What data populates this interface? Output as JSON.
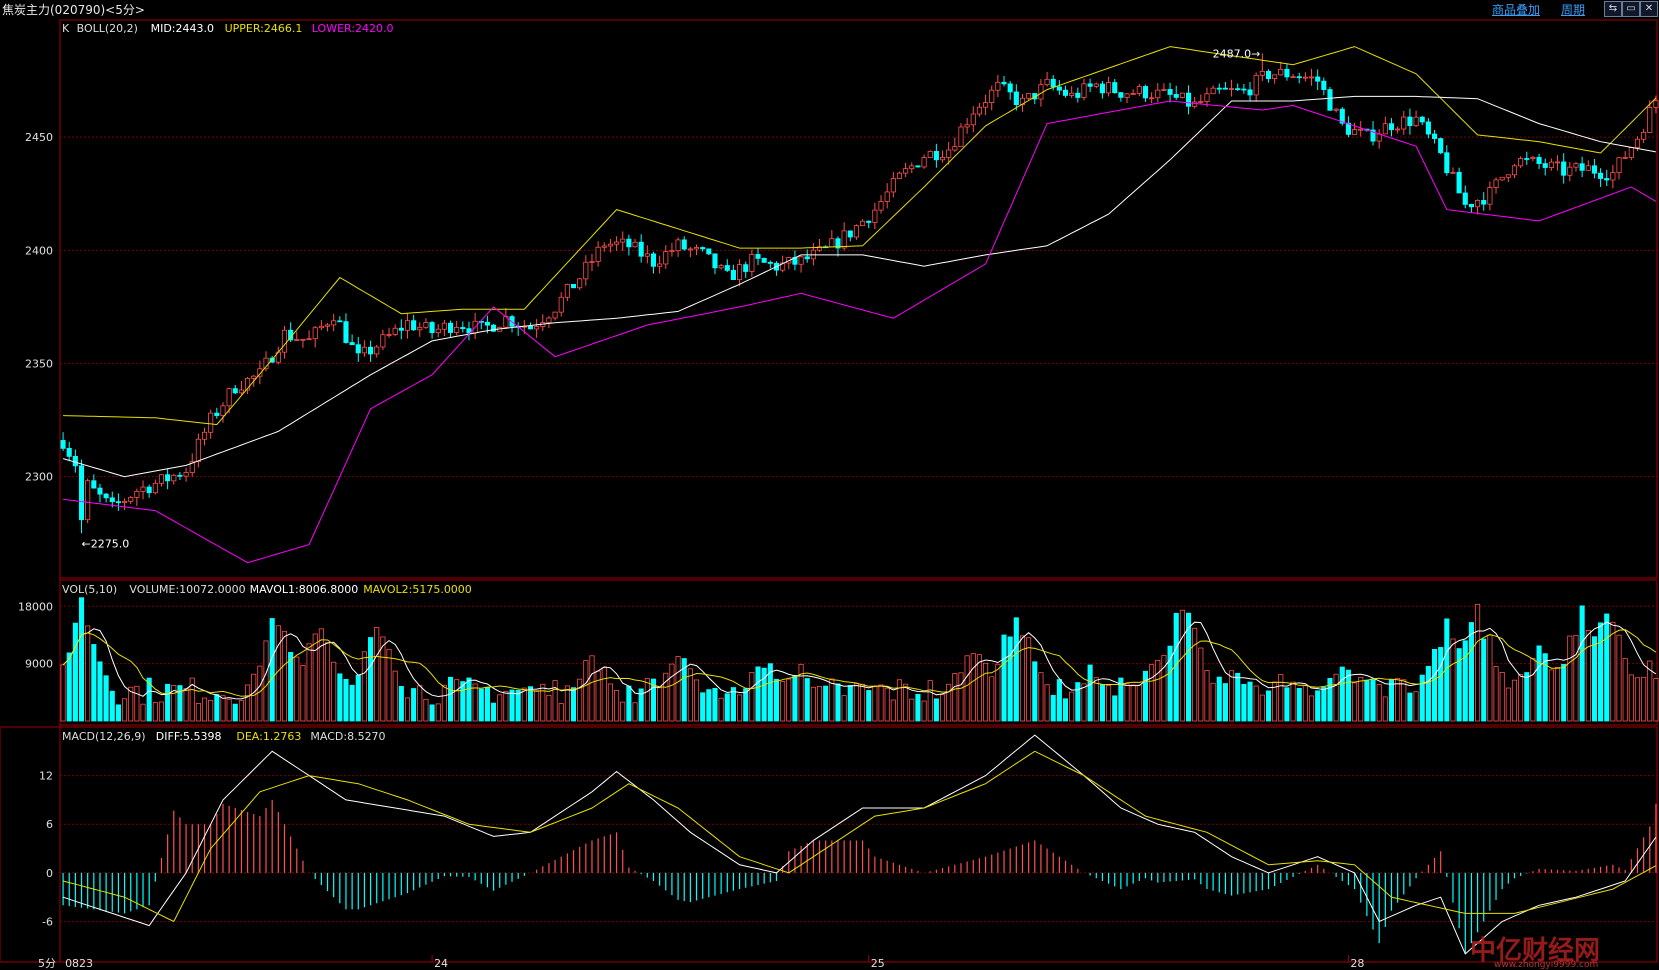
{
  "window": {
    "title": "焦炭主力(020790)<5分>",
    "btn_overlay": "商品叠加",
    "btn_period": "周期",
    "win_controls": [
      "⇆",
      "▭",
      "✕"
    ]
  },
  "colors": {
    "up": "#ff4f4f",
    "down": "#00ffff",
    "mid": "#ffffff",
    "upper": "#e8e000",
    "lower": "#ff00ff",
    "grid": "#7a0000",
    "frame": "#a00000",
    "axis_text": "#e0e0e0"
  },
  "chart_data": [
    {
      "type": "candlestick",
      "id": "price",
      "legend": {
        "prefix": "K",
        "indicator": "BOLL(20,2)",
        "mid": "MID:2443.0",
        "upper": "UPPER:2466.1",
        "lower": "LOWER:2420.0"
      },
      "y_ticks": [
        "2450",
        "2400",
        "2350",
        "2300"
      ],
      "y_tick_values": [
        2450,
        2400,
        2350,
        2300
      ],
      "ylim": [
        2257,
        2500
      ],
      "annotations": {
        "low": "←2275.0",
        "high": "2487.0→",
        "low_value": 2275,
        "high_value": 2487,
        "low_index": 3,
        "high_index": 195
      },
      "bar_count": 260,
      "mid_line": [
        [
          0,
          2308
        ],
        [
          10,
          2300
        ],
        [
          20,
          2305
        ],
        [
          35,
          2320
        ],
        [
          50,
          2345
        ],
        [
          60,
          2360
        ],
        [
          70,
          2365
        ],
        [
          80,
          2368
        ],
        [
          90,
          2370
        ],
        [
          100,
          2373
        ],
        [
          110,
          2385
        ],
        [
          120,
          2398
        ],
        [
          130,
          2398
        ],
        [
          140,
          2393
        ],
        [
          150,
          2398
        ],
        [
          160,
          2402
        ],
        [
          170,
          2416
        ],
        [
          180,
          2440
        ],
        [
          190,
          2466
        ],
        [
          200,
          2466
        ],
        [
          210,
          2468
        ],
        [
          220,
          2468
        ],
        [
          230,
          2467
        ],
        [
          240,
          2456
        ],
        [
          250,
          2448
        ],
        [
          260,
          2443
        ]
      ],
      "upper_line": [
        [
          0,
          2327
        ],
        [
          15,
          2326
        ],
        [
          25,
          2323
        ],
        [
          35,
          2355
        ],
        [
          45,
          2388
        ],
        [
          55,
          2372
        ],
        [
          65,
          2374
        ],
        [
          75,
          2374
        ],
        [
          90,
          2418
        ],
        [
          110,
          2401
        ],
        [
          120,
          2401
        ],
        [
          130,
          2402
        ],
        [
          140,
          2428
        ],
        [
          150,
          2455
        ],
        [
          160,
          2471
        ],
        [
          180,
          2490
        ],
        [
          200,
          2482
        ],
        [
          210,
          2490
        ],
        [
          220,
          2478
        ],
        [
          230,
          2451
        ],
        [
          240,
          2448
        ],
        [
          250,
          2443
        ],
        [
          260,
          2470
        ]
      ],
      "lower_line": [
        [
          0,
          2290
        ],
        [
          15,
          2285
        ],
        [
          30,
          2262
        ],
        [
          40,
          2270
        ],
        [
          50,
          2330
        ],
        [
          60,
          2345
        ],
        [
          70,
          2375
        ],
        [
          80,
          2353
        ],
        [
          95,
          2367
        ],
        [
          110,
          2375
        ],
        [
          120,
          2381
        ],
        [
          135,
          2370
        ],
        [
          150,
          2394
        ],
        [
          160,
          2456
        ],
        [
          180,
          2466
        ],
        [
          195,
          2462
        ],
        [
          200,
          2464
        ],
        [
          210,
          2455
        ],
        [
          220,
          2446
        ],
        [
          225,
          2418
        ],
        [
          240,
          2413
        ],
        [
          255,
          2428
        ],
        [
          260,
          2420
        ]
      ],
      "price_path": [
        [
          0,
          2316
        ],
        [
          4,
          2296
        ],
        [
          8,
          2286
        ],
        [
          12,
          2294
        ],
        [
          16,
          2298
        ],
        [
          20,
          2303
        ],
        [
          24,
          2325
        ],
        [
          28,
          2340
        ],
        [
          32,
          2345
        ],
        [
          36,
          2363
        ],
        [
          40,
          2360
        ],
        [
          44,
          2372
        ],
        [
          48,
          2352
        ],
        [
          52,
          2360
        ],
        [
          56,
          2368
        ],
        [
          60,
          2364
        ],
        [
          64,
          2368
        ],
        [
          68,
          2365
        ],
        [
          72,
          2370
        ],
        [
          76,
          2366
        ],
        [
          80,
          2375
        ],
        [
          84,
          2388
        ],
        [
          88,
          2403
        ],
        [
          92,
          2402
        ],
        [
          96,
          2395
        ],
        [
          100,
          2402
        ],
        [
          104,
          2398
        ],
        [
          108,
          2388
        ],
        [
          112,
          2395
        ],
        [
          116,
          2393
        ],
        [
          120,
          2395
        ],
        [
          124,
          2400
        ],
        [
          128,
          2408
        ],
        [
          132,
          2418
        ],
        [
          136,
          2432
        ],
        [
          140,
          2442
        ],
        [
          144,
          2445
        ],
        [
          148,
          2462
        ],
        [
          152,
          2472
        ],
        [
          156,
          2465
        ],
        [
          160,
          2473
        ],
        [
          164,
          2468
        ],
        [
          168,
          2473
        ],
        [
          172,
          2470
        ],
        [
          176,
          2470
        ],
        [
          180,
          2468
        ],
        [
          184,
          2464
        ],
        [
          188,
          2470
        ],
        [
          192,
          2470
        ],
        [
          196,
          2478
        ],
        [
          200,
          2478
        ],
        [
          204,
          2475
        ],
        [
          208,
          2455
        ],
        [
          212,
          2450
        ],
        [
          216,
          2456
        ],
        [
          220,
          2458
        ],
        [
          224,
          2442
        ],
        [
          228,
          2420
        ],
        [
          232,
          2425
        ],
        [
          236,
          2440
        ],
        [
          240,
          2438
        ],
        [
          244,
          2435
        ],
        [
          248,
          2436
        ],
        [
          252,
          2434
        ],
        [
          256,
          2450
        ],
        [
          260,
          2472
        ]
      ]
    },
    {
      "type": "bar",
      "id": "volume",
      "legend": {
        "indicator": "VOL(5,10)",
        "volume": "VOLUME:10072.0000",
        "mavol1": "MAVOL1:8006.8000",
        "mavol2": "MAVOL2:5175.0000"
      },
      "y_ticks": [
        "18000",
        "9000"
      ],
      "y_tick_values": [
        18000,
        9000
      ],
      "ylim": [
        0,
        21500
      ],
      "spikes": [
        [
          3,
          19500
        ],
        [
          35,
          19000
        ],
        [
          42,
          17000
        ],
        [
          51,
          16000
        ],
        [
          86,
          12000
        ],
        [
          100,
          11500
        ],
        [
          114,
          10800
        ],
        [
          120,
          9500
        ],
        [
          148,
          14000
        ],
        [
          155,
          19000
        ],
        [
          167,
          9000
        ],
        [
          178,
          11000
        ],
        [
          182,
          20500
        ],
        [
          190,
          9000
        ],
        [
          198,
          7500
        ],
        [
          208,
          9500
        ],
        [
          212,
          8000
        ],
        [
          225,
          17500
        ],
        [
          230,
          19500
        ],
        [
          240,
          14000
        ],
        [
          247,
          19500
        ],
        [
          251,
          20500
        ],
        [
          258,
          10200
        ]
      ],
      "base_level": 2500
    },
    {
      "type": "bar",
      "id": "macd",
      "legend": {
        "indicator": "MACD(12,26,9)",
        "diff": "DIFF:5.5398",
        "dea": "DEA:1.2763",
        "macd": "MACD:8.5270"
      },
      "y_ticks": [
        "12",
        "6",
        "0",
        "-6"
      ],
      "y_tick_values": [
        12,
        6,
        0,
        -6
      ],
      "ylim": [
        -10.5,
        17.5
      ],
      "diff_path": [
        [
          0,
          -3
        ],
        [
          8,
          -5
        ],
        [
          14,
          -6.5
        ],
        [
          20,
          0
        ],
        [
          26,
          9
        ],
        [
          34,
          15
        ],
        [
          40,
          12
        ],
        [
          46,
          9
        ],
        [
          54,
          8
        ],
        [
          62,
          7
        ],
        [
          70,
          4.5
        ],
        [
          76,
          5
        ],
        [
          86,
          10
        ],
        [
          90,
          12.5
        ],
        [
          96,
          9
        ],
        [
          102,
          5
        ],
        [
          110,
          1
        ],
        [
          116,
          0
        ],
        [
          122,
          4
        ],
        [
          130,
          8
        ],
        [
          140,
          8
        ],
        [
          150,
          12
        ],
        [
          158,
          17
        ],
        [
          166,
          12
        ],
        [
          172,
          8
        ],
        [
          178,
          6
        ],
        [
          184,
          5
        ],
        [
          190,
          2
        ],
        [
          196,
          0
        ],
        [
          204,
          2
        ],
        [
          210,
          0
        ],
        [
          214,
          -6
        ],
        [
          220,
          -4
        ],
        [
          224,
          -3
        ],
        [
          228,
          -10
        ],
        [
          234,
          -6
        ],
        [
          240,
          -4
        ],
        [
          246,
          -3
        ],
        [
          250,
          -2
        ],
        [
          254,
          -1
        ],
        [
          260,
          5.5
        ]
      ],
      "dea_path": [
        [
          0,
          -1
        ],
        [
          10,
          -3
        ],
        [
          18,
          -6
        ],
        [
          24,
          3
        ],
        [
          32,
          10
        ],
        [
          40,
          12
        ],
        [
          48,
          11
        ],
        [
          56,
          9
        ],
        [
          66,
          6
        ],
        [
          76,
          5
        ],
        [
          86,
          8
        ],
        [
          92,
          11
        ],
        [
          100,
          8
        ],
        [
          110,
          2
        ],
        [
          118,
          0
        ],
        [
          124,
          3
        ],
        [
          132,
          7
        ],
        [
          140,
          8
        ],
        [
          150,
          11
        ],
        [
          158,
          15
        ],
        [
          166,
          12
        ],
        [
          176,
          7
        ],
        [
          186,
          5
        ],
        [
          196,
          1
        ],
        [
          204,
          1.5
        ],
        [
          210,
          1
        ],
        [
          216,
          -3
        ],
        [
          222,
          -4
        ],
        [
          228,
          -5
        ],
        [
          236,
          -5
        ],
        [
          244,
          -3.5
        ],
        [
          252,
          -2
        ],
        [
          260,
          1.3
        ]
      ],
      "hist_last": 8.527
    }
  ],
  "x_axis": {
    "labels": [
      "5分",
      "0823",
      "24",
      "25",
      "28"
    ],
    "label_index": [
      null,
      0,
      60,
      131,
      209
    ]
  },
  "watermark": {
    "brand": "中亿财经网",
    "url": "www.zhongyi9999.com"
  }
}
